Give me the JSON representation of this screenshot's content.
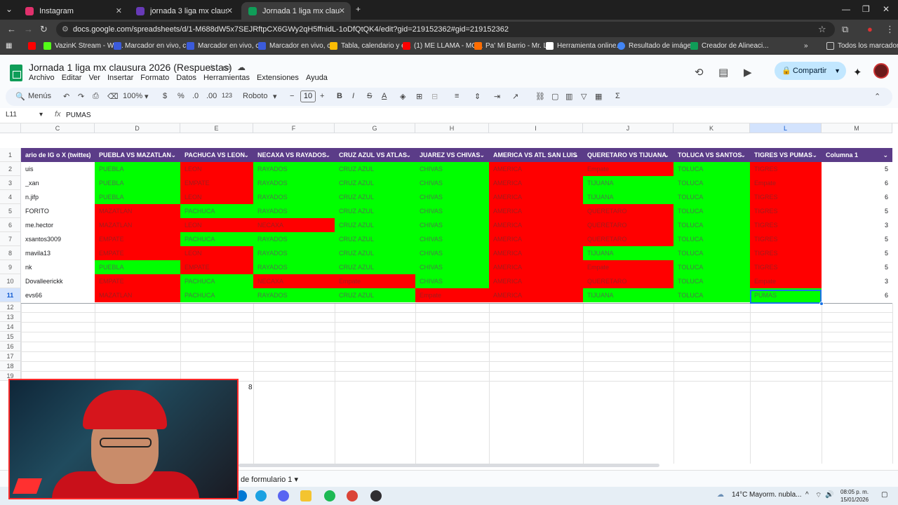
{
  "browser": {
    "tabs": [
      {
        "title": "Instagram",
        "color": "#e1306c"
      },
      {
        "title": "jornada 3 liga mx clausura 2026",
        "color": "#673ab7"
      },
      {
        "title": "Jornada 1 liga mx clausura 2026",
        "color": "#0f9d58"
      }
    ],
    "url": "docs.google.com/spreadsheets/d/1-M688dW5x7SEJRftpCX6GWy2qH5ffnidL-1oDfQtQK4/edit?gid=219152362#gid=219152362",
    "bookmarks": [
      {
        "label": "VazinK Stream - Wa...",
        "color": "#53fc18"
      },
      {
        "label": "Marcador en vivo, c...",
        "color": "#3b5bdb"
      },
      {
        "label": "Marcador en vivo, c...",
        "color": "#3b5bdb"
      },
      {
        "label": "Marcador en vivo, c...",
        "color": "#3b5bdb"
      },
      {
        "label": "Tabla, calendario y e...",
        "color": "#fbbc04"
      },
      {
        "label": "(1) ME LLAMA - MO...",
        "color": "#ff0000"
      },
      {
        "label": "Pa' Mi Barrio - Mr. L...",
        "color": "#ff6d00"
      },
      {
        "label": "Herramienta online...",
        "color": "#ffffff"
      },
      {
        "label": "Resultado de imáge...",
        "color": "#4285f4"
      },
      {
        "label": "Creador de Alineaci...",
        "color": "#0f9d58"
      }
    ],
    "all_bookmarks": "Todos los marcadores"
  },
  "doc": {
    "title": "Jornada 1 liga mx clausura 2026 (Respuestas)",
    "menu": [
      "Archivo",
      "Editar",
      "Ver",
      "Insertar",
      "Formato",
      "Datos",
      "Herramientas",
      "Extensiones",
      "Ayuda"
    ],
    "share_label": "Compartir"
  },
  "toolbar": {
    "menus_label": "Menús",
    "zoom": "100%",
    "currency": "$",
    "percent": "%",
    "dec_less": ".0",
    "dec_more": ".00",
    "number_format": "123",
    "font": "Roboto",
    "font_size": "10"
  },
  "formula_bar": {
    "cell_ref": "L11",
    "fx": "fx",
    "value": "PUMAS"
  },
  "columns": [
    "C",
    "D",
    "E",
    "F",
    "G",
    "H",
    "I",
    "J",
    "K",
    "L",
    "M"
  ],
  "headers": [
    "ario de IG o X (twitter)",
    "PUEBLA VS MAZATLAN",
    "PACHUCA VS LEON",
    "NECAXA VS RAYADOS",
    "CRUZ AZUL VS ATLAS",
    "JUAREZ VS CHIVAS",
    "AMERICA VS ATL SAN LUIS",
    "QUERETARO VS TIJUANA",
    "TOLUCA VS SANTOS",
    "TIGRES VS PUMAS",
    "Columna 1"
  ],
  "rows": [
    {
      "n": "2",
      "user": "uis",
      "picks": [
        [
          "PUEBLA",
          "g"
        ],
        [
          "LEON",
          "r"
        ],
        [
          "RAYADOS",
          "g"
        ],
        [
          "CRUZ AZUL",
          "g"
        ],
        [
          "CHIVAS",
          "g"
        ],
        [
          "AMERICA",
          "r"
        ],
        [
          "Empate",
          "r"
        ],
        [
          "TOLUCA",
          "g"
        ],
        [
          "TIGRES",
          "r"
        ]
      ],
      "score": "5"
    },
    {
      "n": "3",
      "user": "_xan",
      "picks": [
        [
          "PUEBLA",
          "g"
        ],
        [
          "EMPATE",
          "r"
        ],
        [
          "RAYADOS",
          "g"
        ],
        [
          "CRUZ AZUL",
          "g"
        ],
        [
          "CHIVAS",
          "g"
        ],
        [
          "AMERICA",
          "r"
        ],
        [
          "TIJUANA",
          "g"
        ],
        [
          "TOLUCA",
          "g"
        ],
        [
          "Empate",
          "r"
        ]
      ],
      "score": "6"
    },
    {
      "n": "4",
      "user": "n.jifp",
      "picks": [
        [
          "PUEBLA",
          "g"
        ],
        [
          "LEON",
          "r"
        ],
        [
          "RAYADOS",
          "g"
        ],
        [
          "CRUZ AZUL",
          "g"
        ],
        [
          "CHIVAS",
          "g"
        ],
        [
          "AMERICA",
          "r"
        ],
        [
          "TIJUANA",
          "g"
        ],
        [
          "TOLUCA",
          "g"
        ],
        [
          "TIGRES",
          "r"
        ]
      ],
      "score": "6"
    },
    {
      "n": "5",
      "user": "FORITO",
      "picks": [
        [
          "MAZATLAN",
          "r"
        ],
        [
          "PACHUCA",
          "g"
        ],
        [
          "RAYADOS",
          "g"
        ],
        [
          "CRUZ AZUL",
          "g"
        ],
        [
          "CHIVAS",
          "g"
        ],
        [
          "AMERICA",
          "r"
        ],
        [
          "QUERETARO",
          "r"
        ],
        [
          "TOLUCA",
          "g"
        ],
        [
          "TIGRES",
          "r"
        ]
      ],
      "score": "5"
    },
    {
      "n": "6",
      "user": "me.hector",
      "picks": [
        [
          "MAZATLAN",
          "r"
        ],
        [
          "LEON",
          "r"
        ],
        [
          "NECAXA",
          "r"
        ],
        [
          "CRUZ AZUL",
          "g"
        ],
        [
          "CHIVAS",
          "g"
        ],
        [
          "AMERICA",
          "r"
        ],
        [
          "QUERETARO",
          "r"
        ],
        [
          "TOLUCA",
          "g"
        ],
        [
          "TIGRES",
          "r"
        ]
      ],
      "score": "3"
    },
    {
      "n": "7",
      "user": "xsantos3009",
      "picks": [
        [
          "EMPATE",
          "r"
        ],
        [
          "PACHUCA",
          "g"
        ],
        [
          "RAYADOS",
          "g"
        ],
        [
          "CRUZ AZUL",
          "g"
        ],
        [
          "CHIVAS",
          "g"
        ],
        [
          "AMERICA",
          "r"
        ],
        [
          "QUERETARO",
          "r"
        ],
        [
          "TOLUCA",
          "g"
        ],
        [
          "TIGRES",
          "r"
        ]
      ],
      "score": "5"
    },
    {
      "n": "8",
      "user": "mavila13",
      "picks": [
        [
          "EMPATE",
          "r"
        ],
        [
          "LEON",
          "r"
        ],
        [
          "RAYADOS",
          "g"
        ],
        [
          "CRUZ AZUL",
          "g"
        ],
        [
          "CHIVAS",
          "g"
        ],
        [
          "AMERICA",
          "r"
        ],
        [
          "TIJUANA",
          "g"
        ],
        [
          "TOLUCA",
          "g"
        ],
        [
          "TIGRES",
          "r"
        ]
      ],
      "score": "5"
    },
    {
      "n": "9",
      "user": "nk",
      "picks": [
        [
          "PUEBLA",
          "g"
        ],
        [
          "EMPATE",
          "r"
        ],
        [
          "RAYADOS",
          "g"
        ],
        [
          "CRUZ AZUL",
          "g"
        ],
        [
          "CHIVAS",
          "g"
        ],
        [
          "AMERICA",
          "r"
        ],
        [
          "Empate",
          "r"
        ],
        [
          "TOLUCA",
          "g"
        ],
        [
          "TIGRES",
          "r"
        ]
      ],
      "score": "5"
    },
    {
      "n": "10",
      "user": "Dovalleerickk",
      "picks": [
        [
          "EMPATE",
          "r"
        ],
        [
          "PACHUCA",
          "g"
        ],
        [
          "NECAXA",
          "r"
        ],
        [
          "Empate",
          "r"
        ],
        [
          "CHIVAS",
          "g"
        ],
        [
          "AMERICA",
          "r"
        ],
        [
          "QUERETARO",
          "r"
        ],
        [
          "TOLUCA",
          "g"
        ],
        [
          "Empate",
          "r"
        ]
      ],
      "score": "3"
    },
    {
      "n": "11",
      "user": "evs66",
      "picks": [
        [
          "MAZATLAN",
          "r"
        ],
        [
          "PACHUCA",
          "g"
        ],
        [
          "RAYADOS",
          "g"
        ],
        [
          "CRUZ AZUL",
          "g"
        ],
        [
          "Empate",
          "r"
        ],
        [
          "AMERICA",
          "r"
        ],
        [
          "TIJUANA",
          "g"
        ],
        [
          "TOLUCA",
          "g"
        ],
        [
          "PUMAS",
          "g"
        ]
      ],
      "score": "6"
    }
  ],
  "empty_rows": [
    "12",
    "13",
    "14",
    "15",
    "16",
    "17",
    "18",
    "19"
  ],
  "overlay_number": "8",
  "sheet_tab": "de formulario 1",
  "taskbar": {
    "weather": "14°C",
    "weather_desc": "Mayorm. nubla...",
    "time": "08:05 p. m.",
    "date": "15/01/2026"
  }
}
